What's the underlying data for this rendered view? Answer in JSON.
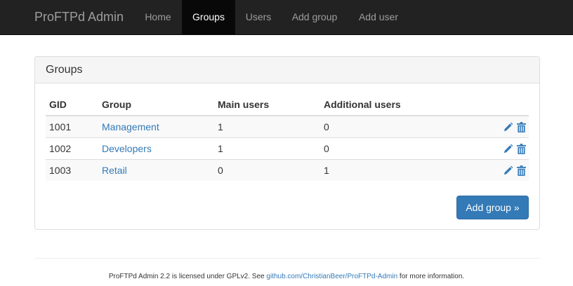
{
  "navbar": {
    "brand": "ProFTPd Admin",
    "items": [
      {
        "label": "Home",
        "active": false
      },
      {
        "label": "Groups",
        "active": true
      },
      {
        "label": "Users",
        "active": false
      },
      {
        "label": "Add group",
        "active": false
      },
      {
        "label": "Add user",
        "active": false
      }
    ]
  },
  "panel": {
    "title": "Groups",
    "table": {
      "headers": [
        "GID",
        "Group",
        "Main users",
        "Additional users"
      ],
      "rows": [
        {
          "gid": "1001",
          "group": "Management",
          "main_users": "1",
          "additional_users": "0"
        },
        {
          "gid": "1002",
          "group": "Developers",
          "main_users": "1",
          "additional_users": "0"
        },
        {
          "gid": "1003",
          "group": "Retail",
          "main_users": "0",
          "additional_users": "1"
        }
      ]
    },
    "add_button_label": "Add group »"
  },
  "footer": {
    "text_before": "ProFTPd Admin 2.2 is licensed under GPLv2. See",
    "link_text": "github.com/ChristianBeer/ProFTPd-Admin",
    "text_after": "for more information."
  },
  "icons": {
    "edit": "pencil-icon",
    "delete": "trash-icon",
    "accent_color": "#337ab7"
  }
}
